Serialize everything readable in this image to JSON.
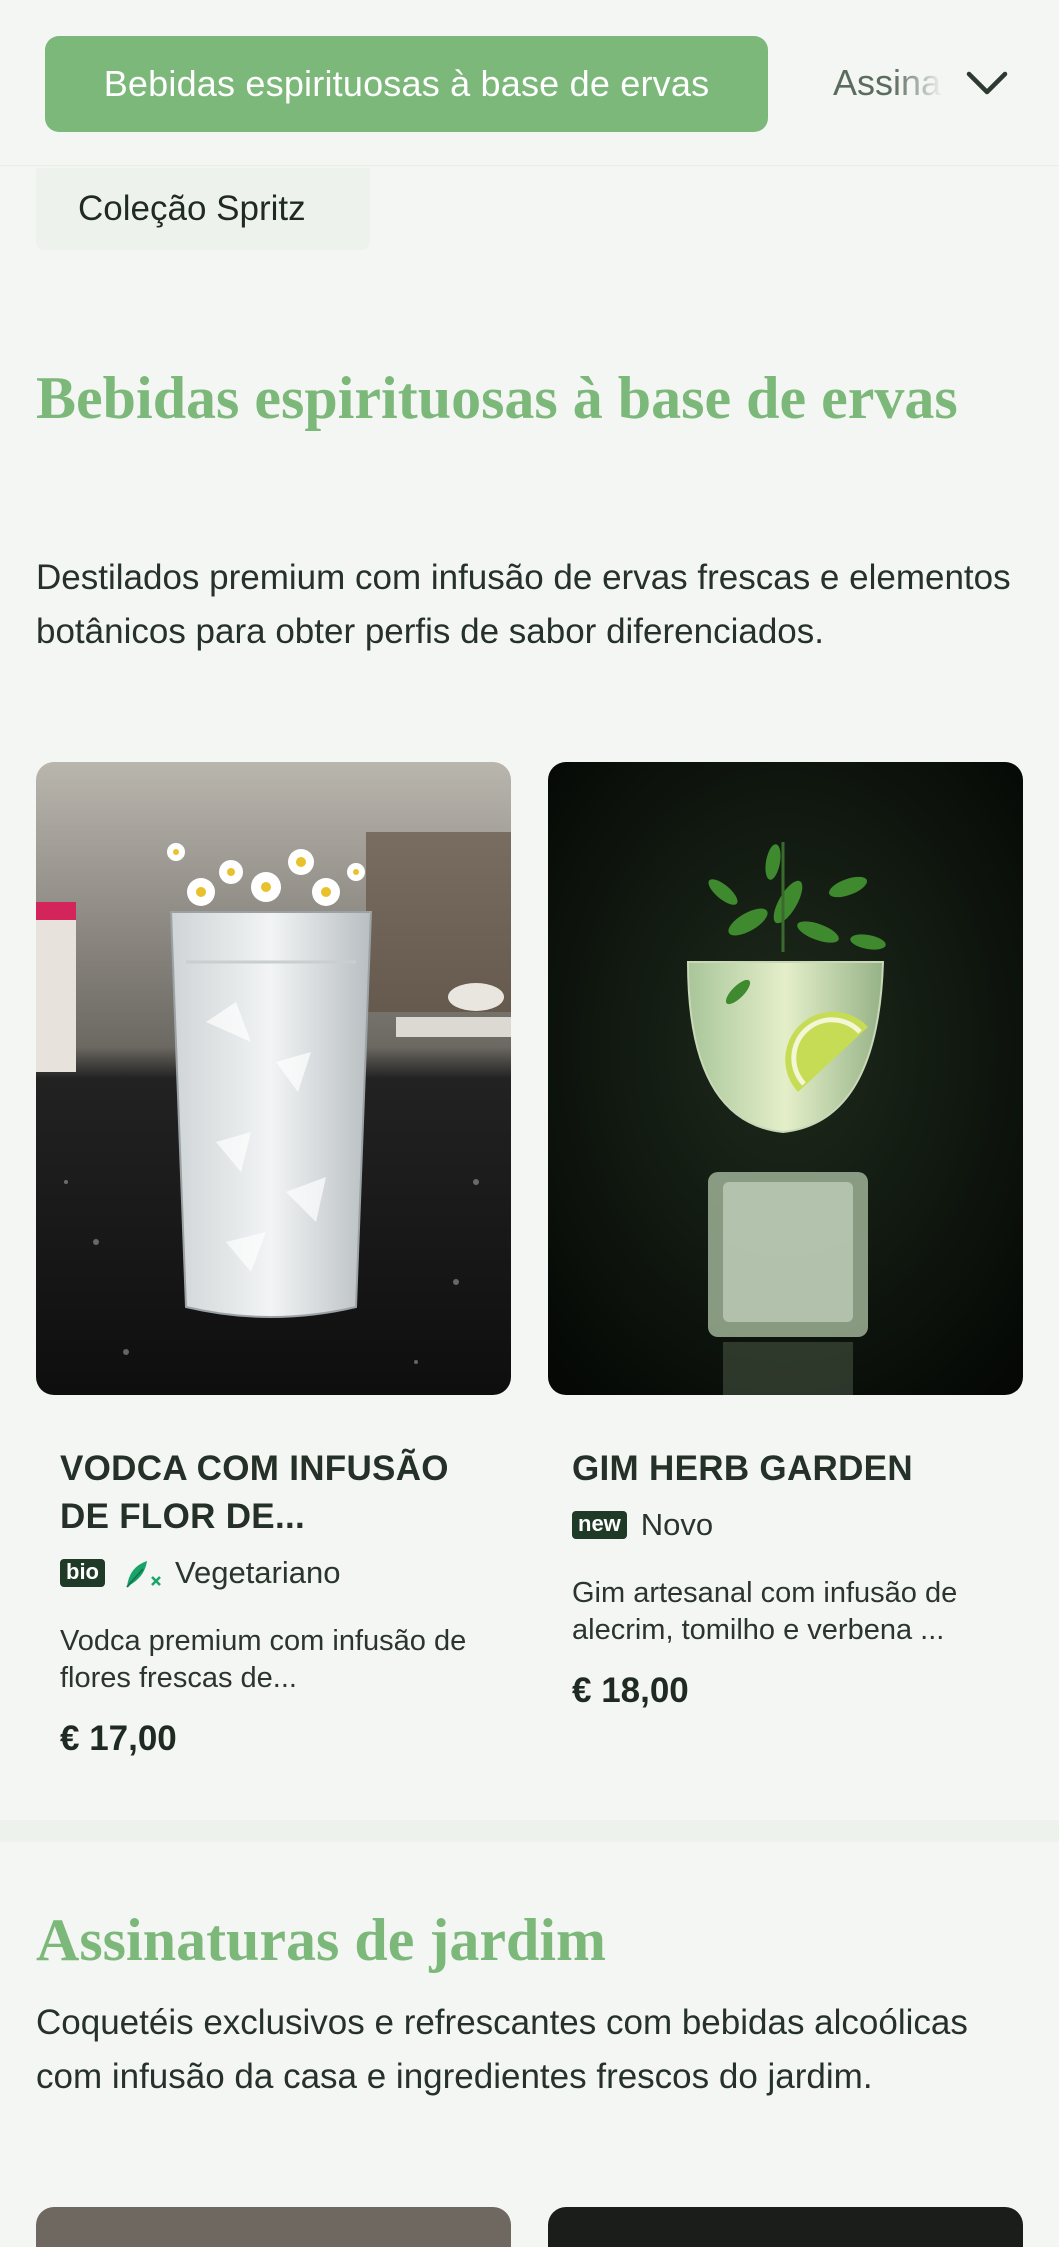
{
  "category_nav": {
    "active": "Bebidas espirituosas à base de ervas",
    "next_partial": "Assinaturas de jardim",
    "chevron_icon": "chevron-down-icon"
  },
  "subcategory": {
    "label": "Coleção Spritz"
  },
  "sections": [
    {
      "title": "Bebidas espirituosas à base de ervas",
      "description": "Destilados premium com infusão de ervas frescas e elementos botânicos para obter perfis de sabor diferenciados.",
      "products": [
        {
          "name": "VODCA COM INFUSÃO DE FLOR DE...",
          "badge": "bio",
          "diet_icon": "vegetarian-leaf-icon",
          "diet_label": "Vegetariano",
          "description": "Vodca premium com infusão de flores frescas de...",
          "price": "€ 17,00",
          "image_icon": "vodka-glass-with-flowers-image"
        },
        {
          "name": "GIM HERB GARDEN",
          "badge": "new",
          "badge_label": "Novo",
          "description": "Gim artesanal com infusão de alecrim, tomilho e verbena ...",
          "price": "€ 18,00",
          "image_icon": "gin-glass-with-herbs-image"
        }
      ]
    },
    {
      "title": "Assinaturas de jardim",
      "description": "Coquetéis exclusivos e refrescantes com bebidas alcoólicas com infusão da casa e ingredientes frescos do jardim."
    }
  ],
  "colors": {
    "accent": "#7bb87a",
    "background": "#f3f6f2",
    "badge_dark": "#1f3a26",
    "vegetarian_green": "#1aa36b"
  }
}
